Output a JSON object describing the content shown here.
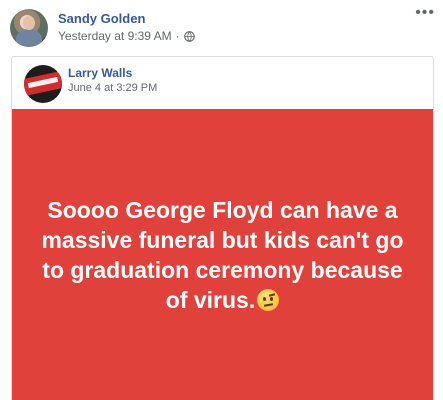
{
  "post": {
    "author": "Sandy Golden",
    "timestamp": "Yesterday at 9:39 AM",
    "separator": "·",
    "privacy_icon": "globe-icon",
    "more_icon": "more-options-icon"
  },
  "shared_post": {
    "author": "Larry Walls",
    "timestamp": "June 4 at 3:29 PM",
    "card": {
      "text": "Soooo George Floyd can have a massive funeral but kids can't go to graduation ceremony because of virus.",
      "emoji": "face-with-raised-eyebrow",
      "background_color": "#e0413a",
      "text_color": "#ffffff"
    }
  },
  "colors": {
    "link_blue": "#385898",
    "meta_gray": "#616770"
  }
}
